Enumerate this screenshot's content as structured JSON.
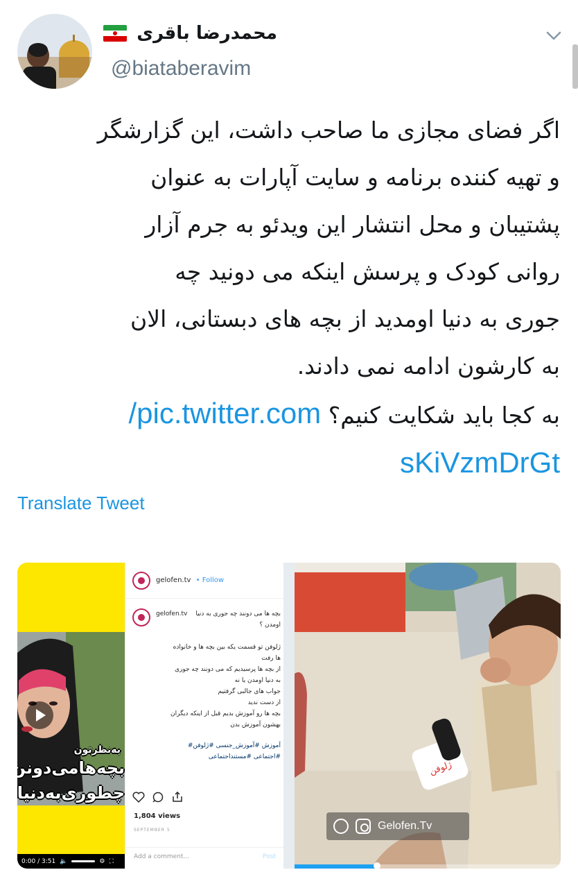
{
  "author": {
    "display_name": "محمدرضا باقری",
    "handle": "@biataberavim",
    "flag": "iran-flag-icon"
  },
  "tweet": {
    "lines": [
      "اگر فضای مجازی ما صاحب داشت، این گزارشگر",
      "و تهیه کننده برنامه و سایت آپارات به عنوان",
      "پشتیبان و محل انتشار این ویدئو به جرم آزار",
      "روانی کودک و پرسش اینکه می دونید چه",
      "جوری به دنیا اومدید از بچه های دبستانی، الان",
      "به کارشون ادامه نمی دادند.",
      "به کجا باید شکایت کنیم؟"
    ],
    "link_part1": "pic.twitter.com/",
    "link_part2": "sKiVzmDrGt",
    "translate_label": "Translate Tweet"
  },
  "media": {
    "insta_account": "gelofen.tv",
    "insta_follow": "Follow",
    "insta_dot": "•",
    "caption_title": "بچه ها می دونند چه جوری به دنیا اومدن ؟",
    "caption_lines": [
      "ژلوفن تو قسمت یکه بین بچه ها و خانواده",
      "ها رفت",
      "از بچه ها پرسیدیم که می دونند چه جوری",
      "به دنیا اومدن یا نه",
      "جواب های جالبی گرفتیم",
      "از دست ندید",
      "بچه ها رو آموزش بدیم قبل از اینکه دیگران",
      "بهشون آموزش بدن"
    ],
    "caption_tags_1": "آموزش #آموزش_جنسی #ژلوفن#",
    "caption_tags_2": "#اجتماعی #مستنداجتماعی",
    "views": "1,804 views",
    "date": "SEPTEMBER 5",
    "comment_placeholder": "Add a comment...",
    "comment_post": "Post",
    "poster_small": "به‌نظرتون",
    "poster_line1": "بچه‌هامی‌دونن",
    "poster_line2": "چطوری‌به‌دنیا",
    "player_time": "0:00 / 3:51",
    "watermark": "Gelofen.Tv",
    "mic_label": "ژلوفن",
    "progress": 0.31
  }
}
